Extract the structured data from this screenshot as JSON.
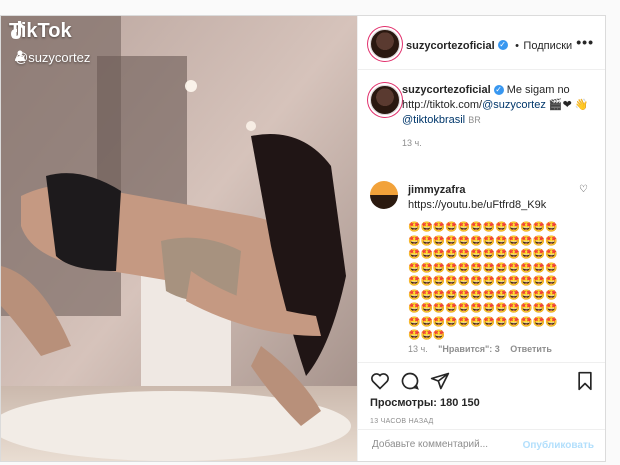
{
  "media": {
    "watermark": "TikTok",
    "handle": "@suzycortez"
  },
  "header": {
    "username": "suzycortezoficial",
    "separator": "•",
    "follow_label": "Подписки",
    "more": "•••"
  },
  "caption": {
    "username": "suzycortezoficial",
    "text_1": "Me sigam no",
    "link_url": "http://tiktok.com/",
    "mention_1": "@suzycortez",
    "text_2": "🎬❤",
    "text_3": "👋",
    "mention_2": "@tiktokbrasil",
    "suffix": "BR",
    "time": "13 ч."
  },
  "comment": {
    "username": "jimmyzafra",
    "link": "https://youtu.be/uFtfrd8_K9k",
    "emojis": "🤩🤩🤩🤩🤩🤩🤩🤩🤩🤩🤩🤩🤩🤩🤩🤩🤩🤩🤩🤩🤩🤩🤩🤩🤩🤩🤩🤩🤩🤩🤩🤩🤩🤩🤩🤩🤩🤩🤩🤩🤩🤩🤩🤩🤩🤩🤩🤩🤩🤩🤩🤩🤩🤩🤩🤩🤩🤩🤩🤩🤩🤩🤩🤩🤩🤩🤩🤩🤩🤩🤩🤩🤩🤩🤩🤩🤩🤩🤩🤩🤩🤩🤩🤩🤩🤩🤩🤩🤩🤩🤩🤩🤩🤩🤩🤩🤩🤩🤩",
    "time": "13 ч.",
    "likes": "\"Нравится\": 3",
    "reply": "Ответить"
  },
  "footer": {
    "views": "Просмотры: 180 150",
    "timestamp": "13 ЧАСОВ НАЗАД",
    "add_comment_placeholder": "Добавьте комментарий...",
    "publish": "Опубликовать"
  },
  "icons": {
    "like": "heart-icon",
    "comment": "comment-icon",
    "share": "share-icon",
    "save": "bookmark-icon"
  },
  "colors": {
    "link": "#00376b",
    "verified": "#3897f0",
    "publish_disabled": "#b2dffc"
  }
}
